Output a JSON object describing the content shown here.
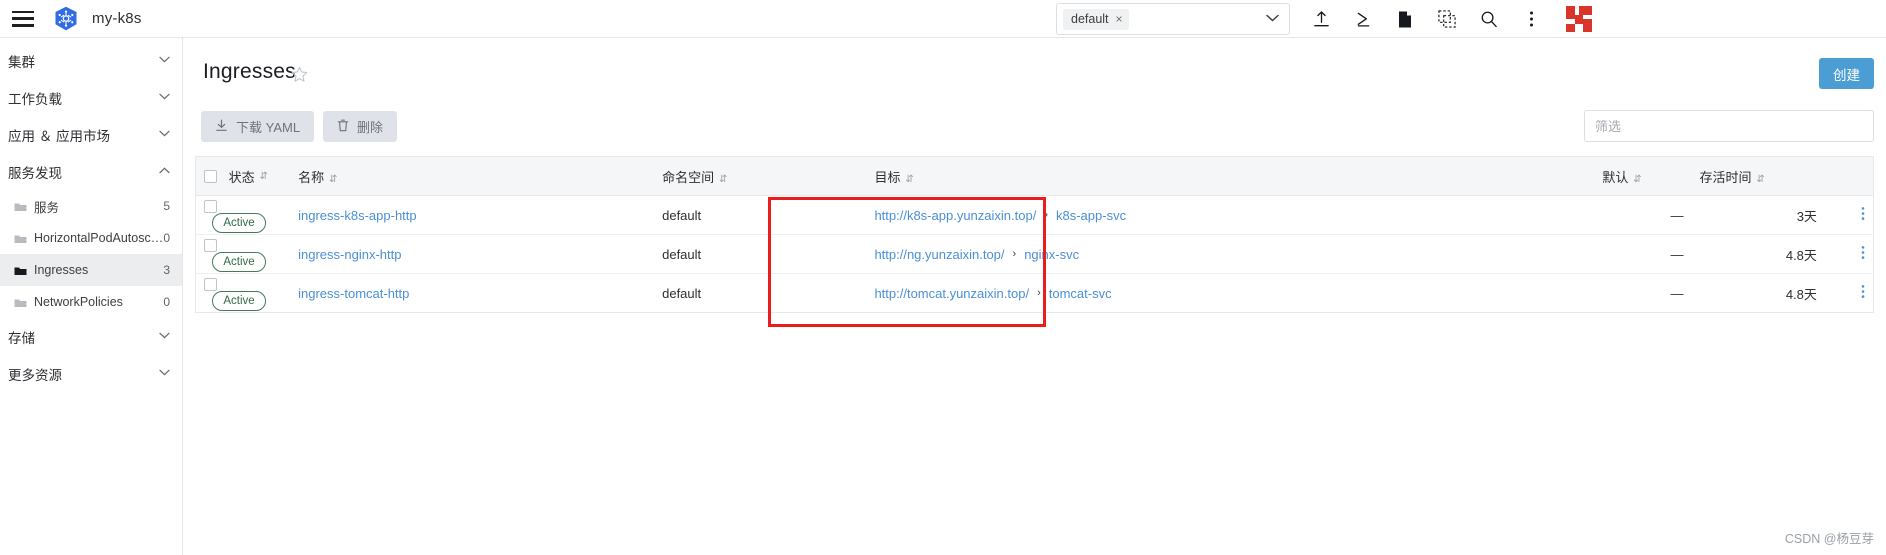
{
  "topbar": {
    "menu_icon": "hamburger-icon",
    "logo_icon": "kubernetes-logo-icon",
    "cluster_name": "my-k8s",
    "namespace": {
      "chip_label": "default",
      "chip_close": "×",
      "caret": "⌵"
    },
    "icons": [
      {
        "name": "upload-icon",
        "glyph": "upload"
      },
      {
        "name": "terminal-icon",
        "glyph": "terminal"
      },
      {
        "name": "file-icon",
        "glyph": "file"
      },
      {
        "name": "snapshot-icon",
        "glyph": "snapshot"
      },
      {
        "name": "search-icon",
        "glyph": "search"
      },
      {
        "name": "overflow-menu-icon",
        "glyph": "kebab"
      }
    ],
    "brandmark_name": "red-brand-icon"
  },
  "sidebar": {
    "groups": [
      {
        "label": "集群",
        "expanded": false
      },
      {
        "label": "工作负载",
        "expanded": false
      },
      {
        "label": "应用 ＆ 应用市场",
        "expanded": false
      },
      {
        "label": "服务发现",
        "expanded": true
      }
    ],
    "items": [
      {
        "label": "服务",
        "count": "5",
        "active": false
      },
      {
        "label": "HorizontalPodAutoscalers",
        "count": "0",
        "active": false
      },
      {
        "label": "Ingresses",
        "count": "3",
        "active": true
      },
      {
        "label": "NetworkPolicies",
        "count": "0",
        "active": false
      }
    ],
    "groups_bottom": [
      {
        "label": "存储",
        "expanded": false
      },
      {
        "label": "更多资源",
        "expanded": false
      }
    ]
  },
  "page": {
    "title": "Ingresses",
    "favorite_icon": "star-icon",
    "create_button": "创建"
  },
  "toolbar": {
    "download_yaml": "下载 YAML",
    "download_icon": "download-icon",
    "delete": "删除",
    "delete_icon": "trash-icon",
    "filter_placeholder": "筛选",
    "filter_value": ""
  },
  "table": {
    "columns": [
      {
        "key": "state",
        "label": "状态",
        "sortable": true
      },
      {
        "key": "name",
        "label": "名称",
        "sortable": true
      },
      {
        "key": "namespace",
        "label": "命名空间",
        "sortable": true
      },
      {
        "key": "target",
        "label": "目标",
        "sortable": true
      },
      {
        "key": "default",
        "label": "默认",
        "sortable": true
      },
      {
        "key": "age",
        "label": "存活时间",
        "sortable": true
      }
    ],
    "rows": [
      {
        "selected": false,
        "state": "Active",
        "name": "ingress-k8s-app-http",
        "namespace": "default",
        "target_url": "http://k8s-app.yunzaixin.top/",
        "target_sep": "›",
        "target_service": "k8s-app-svc",
        "default": "—",
        "age": "3天"
      },
      {
        "selected": false,
        "state": "Active",
        "name": "ingress-nginx-http",
        "namespace": "default",
        "target_url": "http://ng.yunzaixin.top/",
        "target_sep": "›",
        "target_service": "nginx-svc",
        "default": "—",
        "age": "4.8天"
      },
      {
        "selected": false,
        "state": "Active",
        "name": "ingress-tomcat-http",
        "namespace": "default",
        "target_url": "http://tomcat.yunzaixin.top/",
        "target_sep": "›",
        "target_service": "tomcat-svc",
        "default": "—",
        "age": "4.8天"
      }
    ],
    "row_menu_icon": "row-overflow-menu-icon"
  },
  "annotation": {
    "name": "red-highlight-rectangle",
    "color": "#ea1c1c"
  },
  "watermark": "CSDN @杨豆芽",
  "colors": {
    "accent": "#4b9dd4",
    "link": "#4b8fd4",
    "badge": "#2f6b46",
    "annotation": "#ea1c1c",
    "sidebar_active": "#ebedef"
  }
}
